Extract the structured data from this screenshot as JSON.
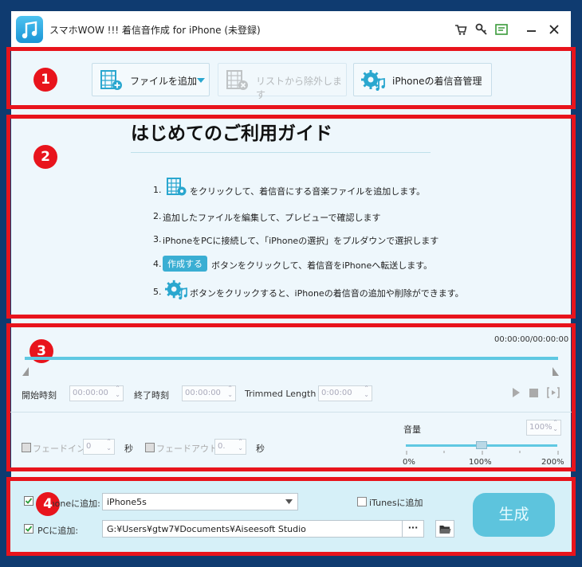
{
  "window": {
    "title": "スマホWOW !!! 着信音作成 for iPhone (未登録)"
  },
  "badges": [
    "1",
    "2",
    "3",
    "4"
  ],
  "toolbar": {
    "add_file": "ファイルを追加",
    "remove": "リストから除外します",
    "manage": "iPhoneの着信音管理"
  },
  "guide": {
    "title": "はじめてのご利用ガイド",
    "steps": [
      {
        "num": "1.",
        "text": "をクリックして、着信音にする音楽ファイルを追加します。"
      },
      {
        "num": "2.",
        "text": "追加したファイルを編集して、プレビューで確認します"
      },
      {
        "num": "3.",
        "text": "iPhoneをPCに接続して、「iPhoneの選択」をプルダウンで選択します"
      },
      {
        "num": "4.",
        "text": "ボタンをクリックして、着信音をiPhoneへ転送します。",
        "button": "作成する"
      },
      {
        "num": "5.",
        "text": "ボタンをクリックすると、iPhoneの着信音の追加や削除ができます。"
      }
    ]
  },
  "trim": {
    "time_display": "00:00:00/00:00:00",
    "start_label": "開始時刻",
    "start_value": "00:00:00",
    "end_label": "終了時刻",
    "end_value": "00:00:00",
    "length_label": "Trimmed Length",
    "length_value": "0:00:00",
    "progress": 0
  },
  "effects": {
    "fadein_label": "フェードイン",
    "fadein_value": "0",
    "fadeout_label": "フェードアウト",
    "fadeout_value": "0.",
    "sec": "秒",
    "volume_label": "音量",
    "volume_value": "100%",
    "volume_level": 0.5,
    "vol_min": "0%",
    "vol_mid": "100%",
    "vol_max": "200%"
  },
  "output": {
    "iphone_label": "iPhoneに追加:",
    "iphone_device": "iPhone5s",
    "itunes_label": "iTunesに追加",
    "pc_label": "PCに追加:",
    "pc_path": "G:¥Users¥gtw7¥Documents¥Aiseesoft Studio",
    "browse": "···",
    "generate": "生成"
  },
  "colors": {
    "accent": "#2aa7cf",
    "highlight": "#e8141c",
    "generate": "#5dc4dd"
  }
}
